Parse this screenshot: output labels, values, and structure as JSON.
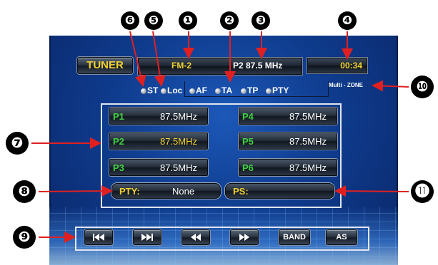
{
  "header": {
    "tuner_label": "TUNER",
    "band": "FM-2",
    "preset_freq": "P2  87.5 MHz",
    "clock": "00:34"
  },
  "indicators": [
    {
      "label": "ST"
    },
    {
      "label": "Loc"
    },
    {
      "label": "AF"
    },
    {
      "label": "TA"
    },
    {
      "label": "TP"
    },
    {
      "label": "PTY"
    }
  ],
  "multizone": "Multi - ZONE",
  "presets": [
    {
      "num": "P1",
      "freq": "87.5MHz"
    },
    {
      "num": "P2",
      "freq": "87.5MHz"
    },
    {
      "num": "P3",
      "freq": "87.5MHz"
    },
    {
      "num": "P4",
      "freq": "87.5MHz"
    },
    {
      "num": "P5",
      "freq": "87.5MHz"
    },
    {
      "num": "P6",
      "freq": "87.5MHz"
    }
  ],
  "pty": {
    "label": "PTY:",
    "value": "None"
  },
  "ps": {
    "label": "PS:",
    "value": ""
  },
  "controls": {
    "band_label": "BAND",
    "as_label": "AS",
    "prev_icon": "skip-back-icon",
    "next_icon": "skip-forward-icon",
    "rewind_icon": "rewind-icon",
    "forward_icon": "fast-forward-icon"
  },
  "callouts": [
    "❶",
    "❷",
    "❸",
    "❹",
    "❺",
    "❻",
    "❼",
    "❽",
    "❾",
    "❿",
    "⓫"
  ],
  "colors": {
    "accent_yellow": "#f0d030",
    "preset_green": "#3fd23f",
    "arrow_red": "#e02020"
  }
}
